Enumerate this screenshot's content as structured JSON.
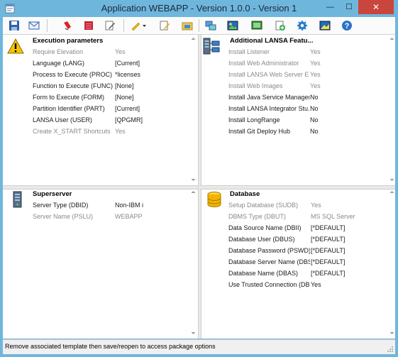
{
  "window": {
    "title": "Application WEBAPP - Version 1.0.0 - Version 1",
    "minimize_symbol": "—",
    "maximize_symbol": "☐",
    "close_symbol": "✕"
  },
  "toolbar": {
    "icons": [
      "save-icon",
      "email-icon",
      "remove-icon",
      "red-list-icon",
      "edit-document-icon",
      "pencil-dropdown-icon",
      "document-edit-icon",
      "folder-sync-icon",
      "transfer-icon",
      "image-icon",
      "screen-icon",
      "add-page-icon",
      "gear-icon",
      "image-settings-icon",
      "help-icon"
    ]
  },
  "panes": {
    "execution": {
      "title": "Execution parameters",
      "icon": "warning-icon",
      "rows": [
        {
          "label": "Require Elevation",
          "value": "Yes",
          "dim": true
        },
        {
          "label": "Language (LANG)",
          "value": "[Current]",
          "dim": false
        },
        {
          "label": "Process to Execute (PROC)",
          "value": "*licenses",
          "dim": false
        },
        {
          "label": "Function to Execute (FUNC)",
          "value": "[None]",
          "dim": false
        },
        {
          "label": "Form to Execute (FORM)",
          "value": "[None]",
          "dim": false
        },
        {
          "label": "Partition Identifier (PART)",
          "value": "[Current]",
          "dim": false
        },
        {
          "label": "LANSA User (USER)",
          "value": "[QPGMR]",
          "dim": false
        },
        {
          "label": "Create X_START Shortcuts",
          "value": "Yes",
          "dim": true
        }
      ]
    },
    "features": {
      "title": "Additional LANSA Featu...",
      "icon": "server-network-icon",
      "rows": [
        {
          "label": "Install Listener",
          "value": "Yes",
          "dim": true
        },
        {
          "label": "Install Web Administrator",
          "value": "Yes",
          "dim": true
        },
        {
          "label": "Install LANSA Web Server E...",
          "value": "Yes",
          "dim": true
        },
        {
          "label": "Install Web Images",
          "value": "Yes",
          "dim": true
        },
        {
          "label": "Install Java Service Manager",
          "value": "No",
          "dim": false
        },
        {
          "label": "Install LANSA Integrator Stu...",
          "value": "No",
          "dim": false
        },
        {
          "label": "Install LongRange",
          "value": "No",
          "dim": false
        },
        {
          "label": "Install Git Deploy Hub",
          "value": "No",
          "dim": false
        }
      ]
    },
    "superserver": {
      "title": "Superserver",
      "icon": "server-icon",
      "rows": [
        {
          "label": "Server Type (DBID)",
          "value": "Non-IBM i",
          "dim": false
        },
        {
          "label": "Server Name (PSLU)",
          "value": "WEBAPP",
          "dim": true
        }
      ]
    },
    "database": {
      "title": "Database",
      "icon": "database-icon",
      "rows": [
        {
          "label": "Setup Database (SUDB)",
          "value": "Yes",
          "dim": true
        },
        {
          "label": "DBMS Type (DBUT)",
          "value": "MS SQL Server",
          "dim": true
        },
        {
          "label": "Data Source Name (DBII)",
          "value": "[*DEFAULT]",
          "dim": false
        },
        {
          "label": "Database User (DBUS)",
          "value": "[*DEFAULT]",
          "dim": false
        },
        {
          "label": "Database Password (PSWD)",
          "value": "[*DEFAULT]",
          "dim": false
        },
        {
          "label": "Database Server Name (DBS...",
          "value": "[*DEFAULT]",
          "dim": false
        },
        {
          "label": "Database Name (DBAS)",
          "value": "[*DEFAULT]",
          "dim": false
        },
        {
          "label": "Use Trusted Connection (DB...",
          "value": "Yes",
          "dim": false
        }
      ]
    }
  },
  "statusbar": {
    "text": "Remove associated template then save/reopen to access package options"
  },
  "colors": {
    "titlebar": "#6fb6dd",
    "close_button": "#c9463d",
    "dim_text": "#8a8a8a"
  }
}
